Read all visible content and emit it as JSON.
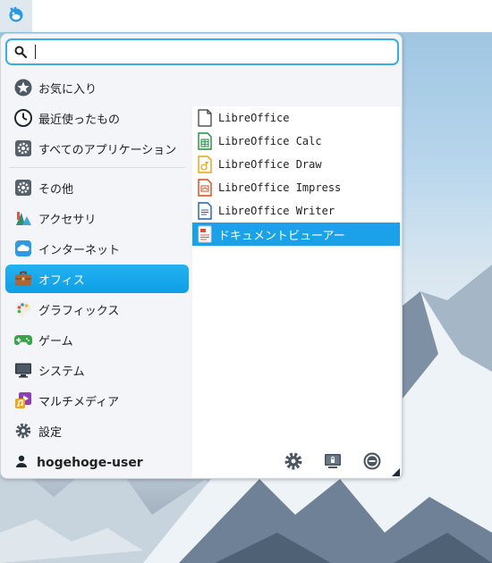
{
  "search": {
    "value": "",
    "placeholder": ""
  },
  "categories_top": [
    {
      "label": "お気に入り",
      "icon": "star-icon"
    },
    {
      "label": "最近使ったもの",
      "icon": "clock-icon"
    },
    {
      "label": "すべてのアプリケーション",
      "icon": "gear-icon"
    }
  ],
  "categories": [
    {
      "label": "その他",
      "icon": "gear-icon"
    },
    {
      "label": "アクセサリ",
      "icon": "accessories-icon"
    },
    {
      "label": "インターネット",
      "icon": "cloud-icon"
    },
    {
      "label": "オフィス",
      "icon": "briefcase-icon",
      "active": true
    },
    {
      "label": "グラフィックス",
      "icon": "palette-icon"
    },
    {
      "label": "ゲーム",
      "icon": "gamepad-icon"
    },
    {
      "label": "システム",
      "icon": "monitor-icon"
    },
    {
      "label": "マルチメディア",
      "icon": "multimedia-icon"
    },
    {
      "label": "設定",
      "icon": "settings-icon"
    }
  ],
  "apps": [
    {
      "label": "LibreOffice",
      "icon": "libreoffice-icon"
    },
    {
      "label": "LibreOffice Calc",
      "icon": "libreoffice-calc-icon"
    },
    {
      "label": "LibreOffice Draw",
      "icon": "libreoffice-draw-icon"
    },
    {
      "label": "LibreOffice Impress",
      "icon": "libreoffice-impress-icon"
    },
    {
      "label": "LibreOffice Writer",
      "icon": "libreoffice-writer-icon"
    },
    {
      "label": "ドキュメントビューアー",
      "icon": "document-viewer-icon",
      "active": true
    }
  ],
  "footer": {
    "username": "hogehoge-user"
  },
  "colors": {
    "accent": "#1aa1e8",
    "search_border": "#3aaee3"
  }
}
